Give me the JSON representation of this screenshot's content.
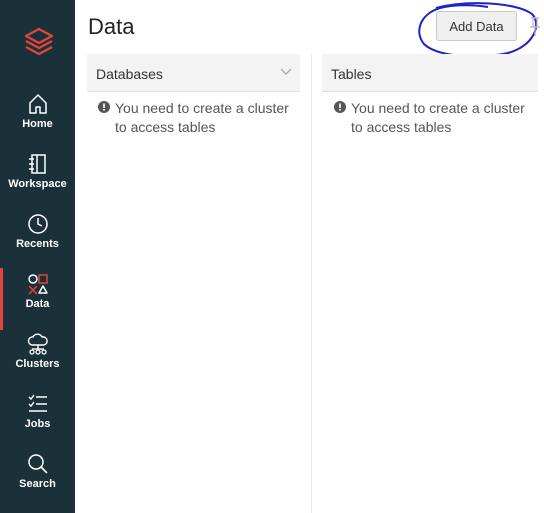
{
  "sidebar": {
    "items": [
      {
        "label": "Home",
        "icon": "home-icon"
      },
      {
        "label": "Workspace",
        "icon": "workspace-icon"
      },
      {
        "label": "Recents",
        "icon": "clock-icon"
      },
      {
        "label": "Data",
        "icon": "data-icon",
        "active": true
      },
      {
        "label": "Clusters",
        "icon": "cloud-cluster-icon"
      },
      {
        "label": "Jobs",
        "icon": "checklist-icon"
      },
      {
        "label": "Search",
        "icon": "search-icon"
      }
    ],
    "colors": {
      "background": "#1b3139",
      "active_accent": "#e0443a",
      "logo": "#e0443a"
    }
  },
  "header": {
    "title": "Data",
    "add_button_label": "Add Data"
  },
  "panels": {
    "databases": {
      "title": "Databases",
      "message": "You need to create a cluster to access tables"
    },
    "tables": {
      "title": "Tables",
      "message": "You need to create a cluster to access tables"
    }
  }
}
